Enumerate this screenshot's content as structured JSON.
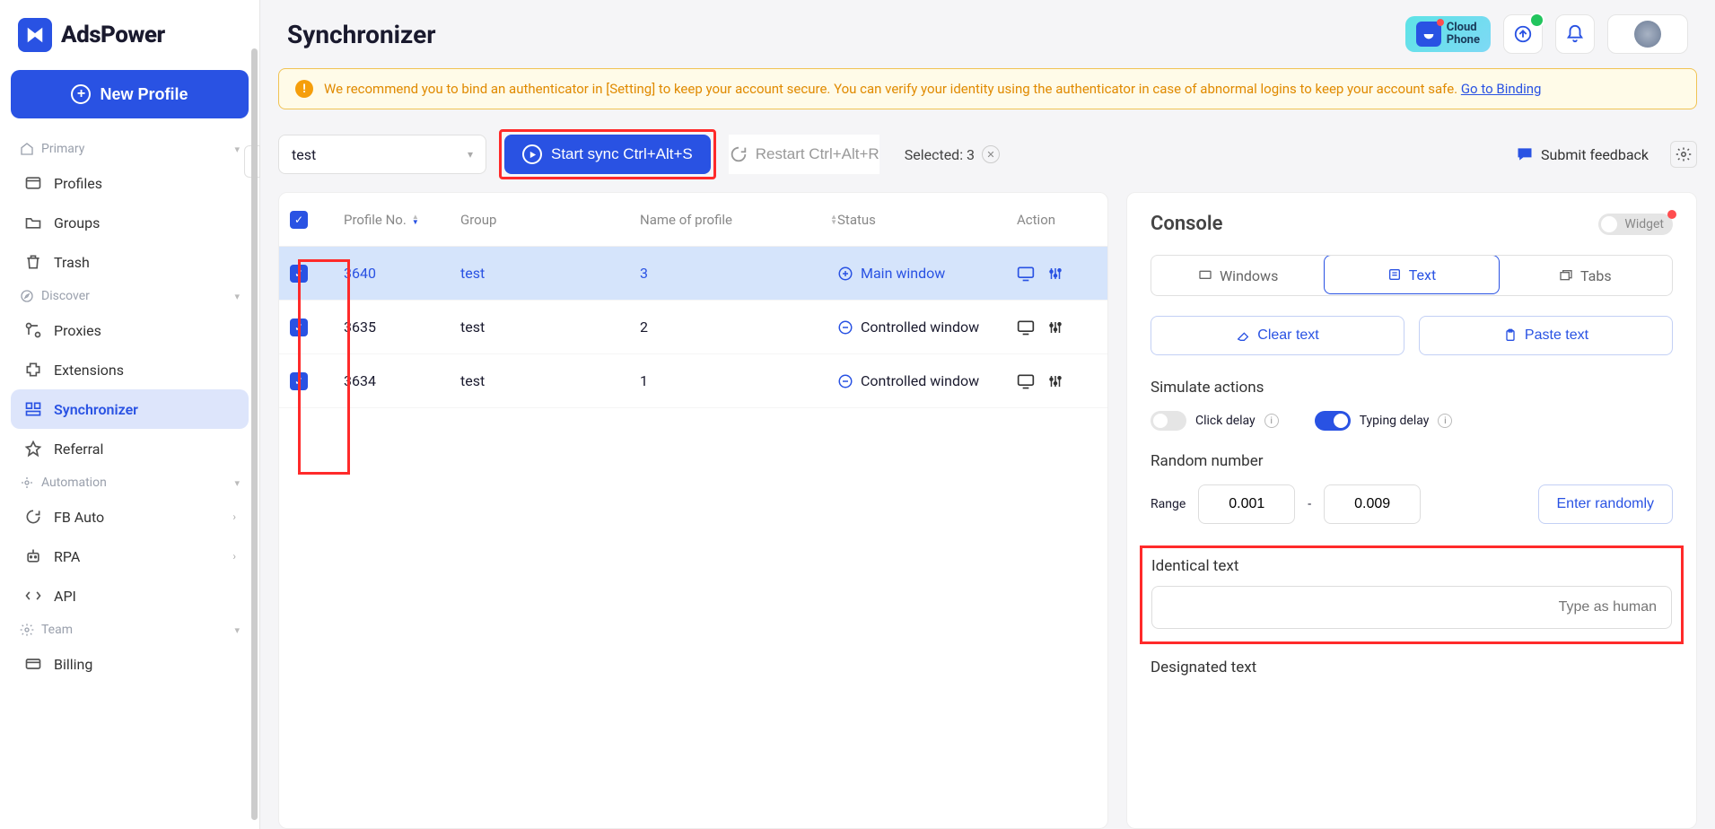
{
  "brand": "AdsPower",
  "sidebar": {
    "new_profile": "New Profile",
    "sections": {
      "primary": "Primary",
      "discover": "Discover",
      "automation": "Automation",
      "team": "Team"
    },
    "items": {
      "profiles": "Profiles",
      "groups": "Groups",
      "trash": "Trash",
      "proxies": "Proxies",
      "extensions": "Extensions",
      "synchronizer": "Synchronizer",
      "referral": "Referral",
      "fb_auto": "FB Auto",
      "rpa": "RPA",
      "api": "API",
      "billing": "Billing"
    }
  },
  "page": {
    "title": "Synchronizer"
  },
  "topbar": {
    "cloud_phone_l1": "Cloud",
    "cloud_phone_l2": "Phone"
  },
  "alert": {
    "text": "We recommend you to bind an authenticator in [Setting] to keep your account secure. You can verify your identity using the authenticator in case of abnormal logins to keep your account safe. ",
    "link": "Go to Binding"
  },
  "toolbar": {
    "group_selected": "test",
    "start_sync": "Start sync Ctrl+Alt+S",
    "restart": "Restart Ctrl+Alt+R",
    "selected_label": "Selected: 3",
    "feedback": "Submit feedback"
  },
  "table": {
    "headers": {
      "profile_no": "Profile No.",
      "group": "Group",
      "name": "Name of profile",
      "status": "Status",
      "action": "Action"
    },
    "rows": [
      {
        "no": "3640",
        "group": "test",
        "name": "3",
        "status": "Main window",
        "selected": true
      },
      {
        "no": "3635",
        "group": "test",
        "name": "2",
        "status": "Controlled window",
        "selected": false
      },
      {
        "no": "3634",
        "group": "test",
        "name": "1",
        "status": "Controlled window",
        "selected": false
      }
    ]
  },
  "console": {
    "title": "Console",
    "widget": "Widget",
    "tabs": {
      "windows": "Windows",
      "text": "Text",
      "tabs": "Tabs"
    },
    "clear_text": "Clear text",
    "paste_text": "Paste text",
    "simulate_actions": "Simulate actions",
    "click_delay": "Click delay",
    "typing_delay": "Typing delay",
    "random_number": "Random number",
    "range_label": "Range",
    "range_min": "0.001",
    "range_max": "0.009",
    "enter_randomly": "Enter randomly",
    "identical_text": "Identical text",
    "identical_placeholder": "Type as human",
    "designated_text": "Designated text"
  }
}
